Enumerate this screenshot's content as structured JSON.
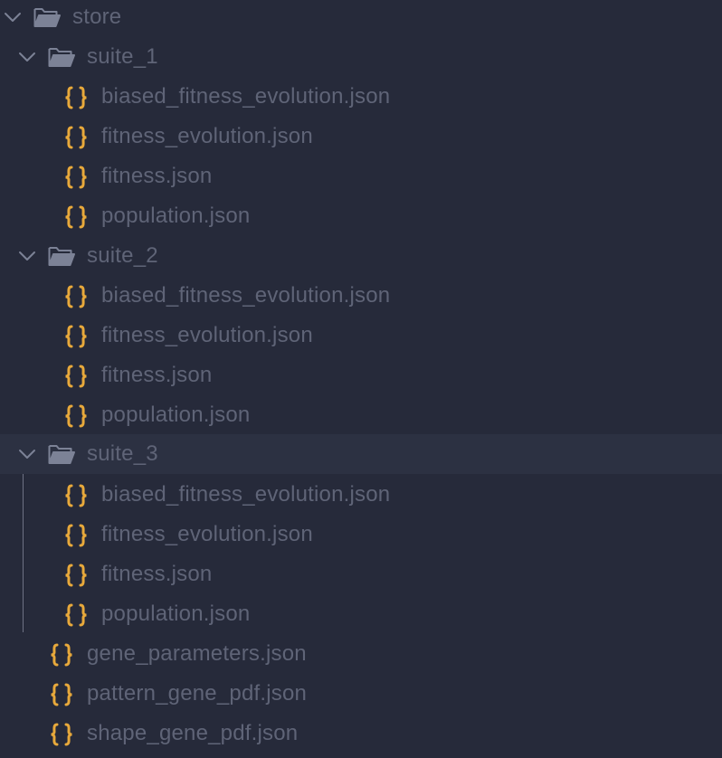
{
  "tree": {
    "root": {
      "label": "store",
      "expanded": true
    },
    "suite_1": {
      "label": "suite_1",
      "files": [
        "biased_fitness_evolution.json",
        "fitness_evolution.json",
        "fitness.json",
        "population.json"
      ]
    },
    "suite_2": {
      "label": "suite_2",
      "files": [
        "biased_fitness_evolution.json",
        "fitness_evolution.json",
        "fitness.json",
        "population.json"
      ]
    },
    "suite_3": {
      "label": "suite_3",
      "selected": true,
      "files": [
        "biased_fitness_evolution.json",
        "fitness_evolution.json",
        "fitness.json",
        "population.json"
      ]
    },
    "root_files": [
      "gene_parameters.json",
      "pattern_gene_pdf.json",
      "shape_gene_pdf.json"
    ]
  },
  "icons": {
    "folder": "folder-open-icon",
    "file": "json-file-icon",
    "chevron": "chevron-down-icon"
  },
  "colors": {
    "background": "#262a3a",
    "selected_row": "#2c3142",
    "text": "#5f6477",
    "json_icon": "#e8a93b",
    "folder_icon": "#7c8296"
  }
}
